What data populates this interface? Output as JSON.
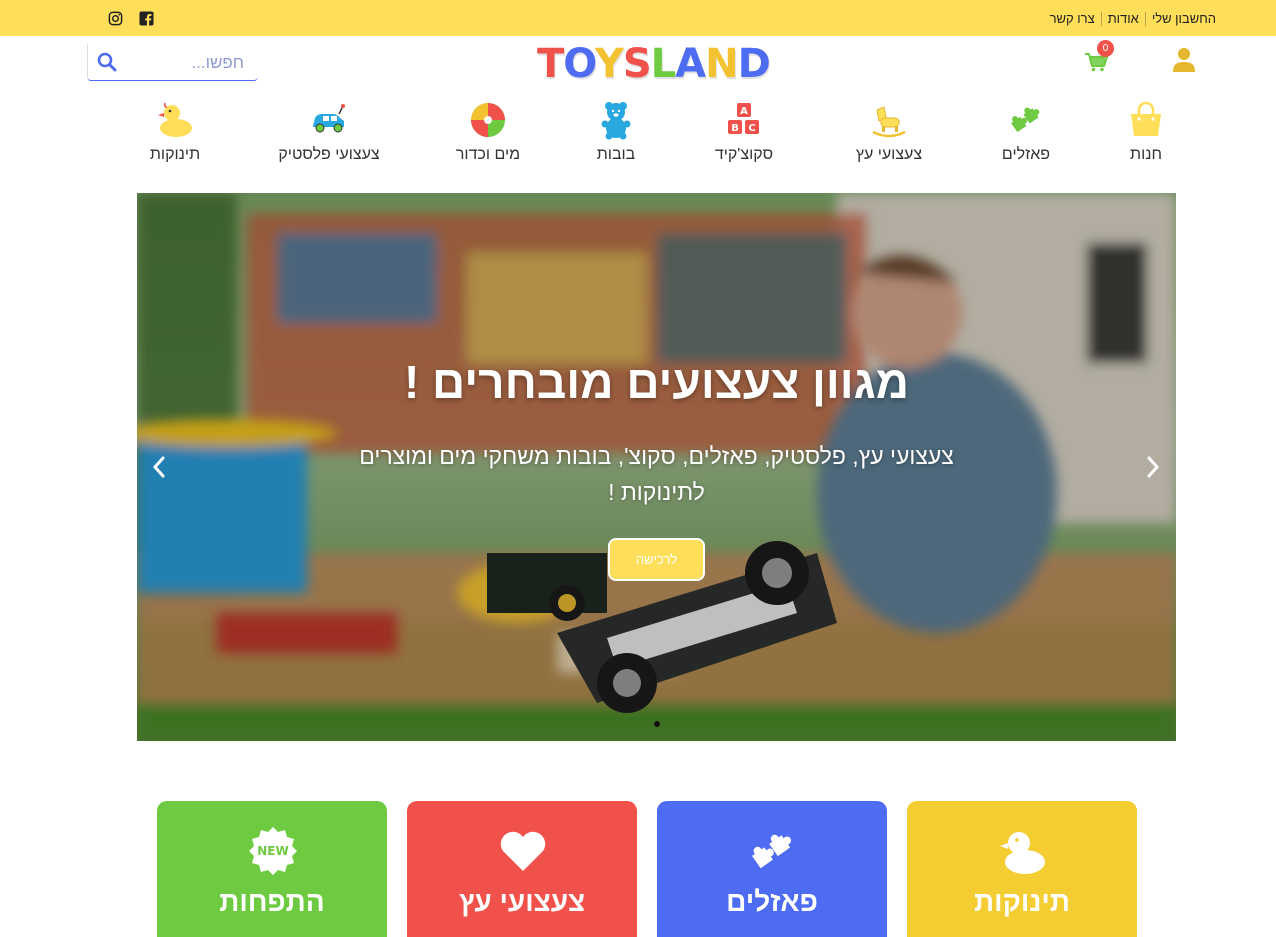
{
  "topbar": {
    "links": [
      "החשבון שלי",
      "אודות",
      "צרו קשר"
    ],
    "social": [
      {
        "name": "facebook",
        "icon": "facebook-icon"
      },
      {
        "name": "instagram",
        "icon": "instagram-icon"
      }
    ],
    "bg": "#FFDF59"
  },
  "header": {
    "logo": "TOYSLAND",
    "logo_colors": [
      "#F0514B",
      "#4E6CF2",
      "#F3C230",
      "#F0514B",
      "#6DCA41",
      "#4E6CF2",
      "#F3C230",
      "#4E6CF2"
    ],
    "search_placeholder": "חפשו...",
    "cart_count": "0"
  },
  "categories": [
    {
      "label": "חנות",
      "icon": "shopping-bag-icon"
    },
    {
      "label": "פאזלים",
      "icon": "puzzle-icon"
    },
    {
      "label": "צעצועי עץ",
      "icon": "rocking-horse-icon"
    },
    {
      "label": "סקוצ'קיד",
      "icon": "abc-blocks-icon"
    },
    {
      "label": "בובות",
      "icon": "teddy-bear-icon"
    },
    {
      "label": "מים וכדור",
      "icon": "beach-ball-icon"
    },
    {
      "label": "צעצועי פלסטיק",
      "icon": "toy-car-icon"
    },
    {
      "label": "תינוקות",
      "icon": "rubber-duck-icon"
    }
  ],
  "hero": {
    "title": "מגוון צעצועים מובחרים !",
    "subtitle_line1": "צעצועי עץ, פלסטיק, פאזלים, סקוצ', בובות משחקי מים ומוצרים",
    "subtitle_line2": "לתינוקות !",
    "cta": "לרכישה",
    "slide_count": 1
  },
  "tiles": [
    {
      "label": "תינוקות",
      "icon": "rubber-duck-icon",
      "color": "#F3CD31"
    },
    {
      "label": "פאזלים",
      "icon": "puzzle-icon",
      "color": "#4E6CF2"
    },
    {
      "label": "צעצועי עץ",
      "icon": "heart-icon",
      "color": "#F0514B"
    },
    {
      "label": "התפחות",
      "icon": "new-badge-icon",
      "color": "#6DCA41"
    }
  ]
}
